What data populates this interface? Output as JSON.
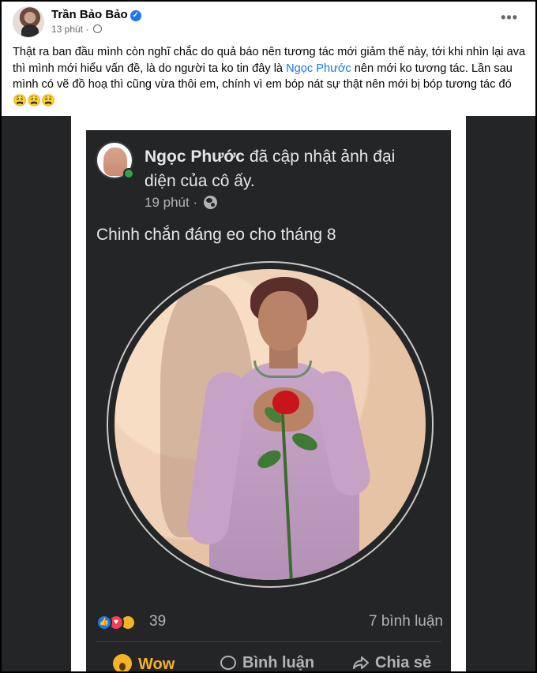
{
  "post": {
    "author": "Trần Bảo Bảo",
    "time": "13 phút",
    "more_label": "•••",
    "text_before_mention": "Thật ra ban đầu mình còn nghĩ chắc do quả báo nên tương tác mới giảm thế này, tới khi nhìn lại ava thì mình mới hiểu vấn đề, là do người ta ko tin đây là ",
    "mention": "Ngọc Phước",
    "text_after_mention": " nên mới ko tương tác. Lần sau mình có vẽ đồ hoạ thì cũng vừa thôi em, chính vì em bóp nát sự thật nên mới bị bóp tương tác đó 😩😩😩"
  },
  "shared": {
    "author": "Ngọc Phước",
    "action": " đã cập nhật ảnh đại diện của cô ấy.",
    "time": "19 phút · ",
    "caption": "Chinh chắn đáng eo cho tháng 8",
    "reaction_count": "39",
    "comment_count": "7 bình luận",
    "actions": {
      "wow": "Wow",
      "comment": "Bình luận",
      "share": "Chia sẻ"
    }
  },
  "icons": [
    "verified-icon",
    "globe-icon",
    "more-icon",
    "like-reaction-icon",
    "love-reaction-icon",
    "care-reaction-icon",
    "wow-icon",
    "comment-icon",
    "share-icon"
  ],
  "colors": {
    "accent": "#1877f2",
    "online": "#31a24c",
    "dark_bg": "#242526",
    "wow": "#f7b125"
  }
}
